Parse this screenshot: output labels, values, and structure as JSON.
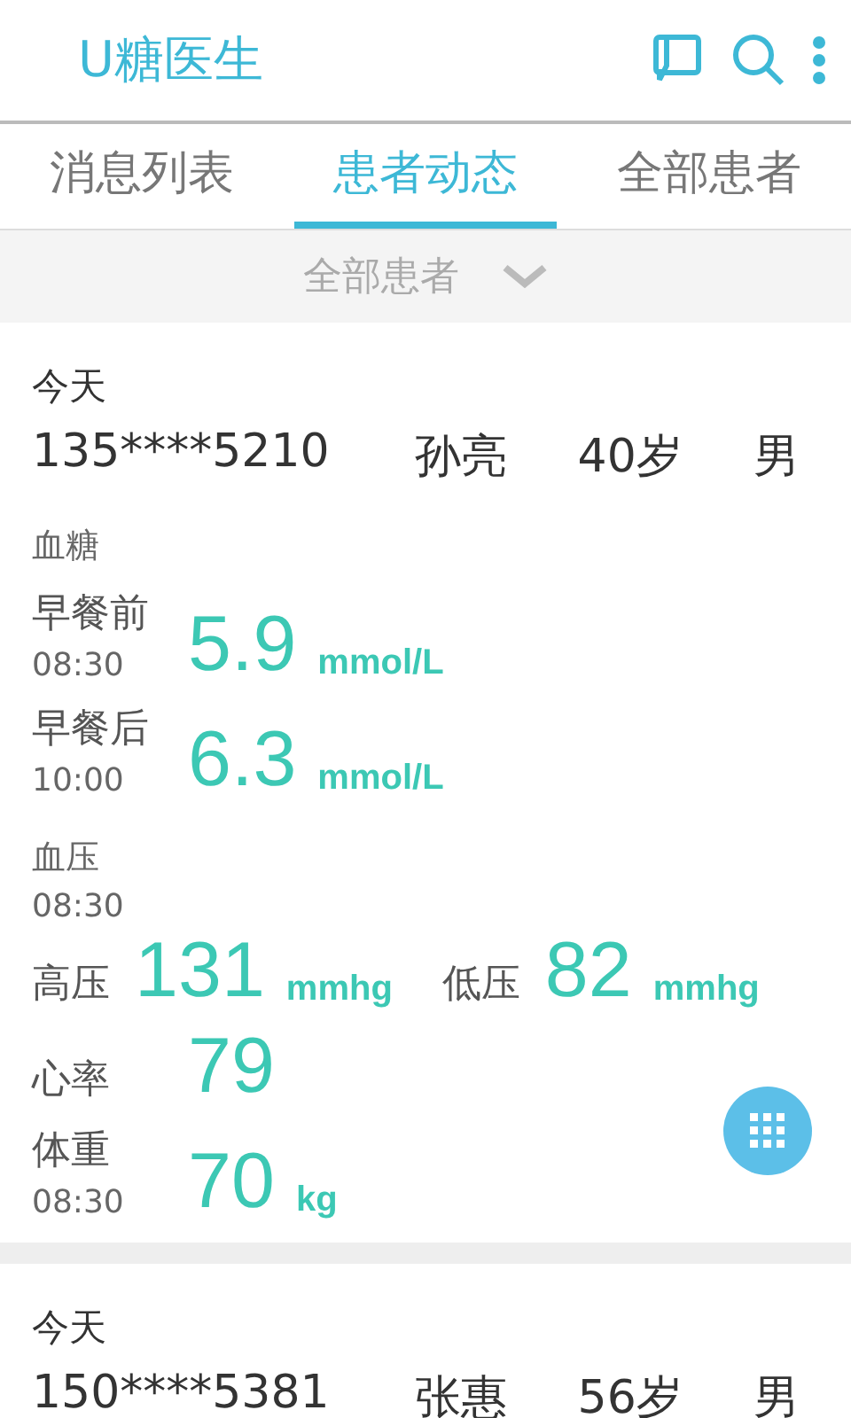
{
  "app_title": "U糖医生",
  "tabs": [
    {
      "label": "消息列表",
      "selected": false
    },
    {
      "label": "患者动态",
      "selected": true
    },
    {
      "label": "全部患者",
      "selected": false
    }
  ],
  "filter": {
    "label": "全部患者"
  },
  "cards": [
    {
      "date": "今天",
      "phone": "135****5210",
      "name": "孙亮",
      "age": "40岁",
      "gender": "男",
      "blocks": [
        {
          "kind": "heading",
          "text": "血糖"
        },
        {
          "kind": "reading",
          "label": "早餐前",
          "time": "08:30",
          "value": "5.9",
          "unit": "mmol/L"
        },
        {
          "kind": "reading",
          "label": "早餐后",
          "time": "10:00",
          "value": "6.3",
          "unit": "mmol/L"
        },
        {
          "kind": "heading",
          "text": "血压",
          "time": "08:30"
        },
        {
          "kind": "pair",
          "items": [
            {
              "label": "高压",
              "value": "131",
              "unit": "mmhg"
            },
            {
              "label": "低压",
              "value": "82",
              "unit": "mmhg"
            }
          ]
        },
        {
          "kind": "reading",
          "label": "心率",
          "value": "79"
        },
        {
          "kind": "reading",
          "label": "体重",
          "time": "08:30",
          "value": "70",
          "unit": "kg"
        }
      ]
    },
    {
      "date": "今天",
      "phone": "150****5381",
      "name": "张惠",
      "age": "56岁",
      "gender": "男"
    }
  ]
}
